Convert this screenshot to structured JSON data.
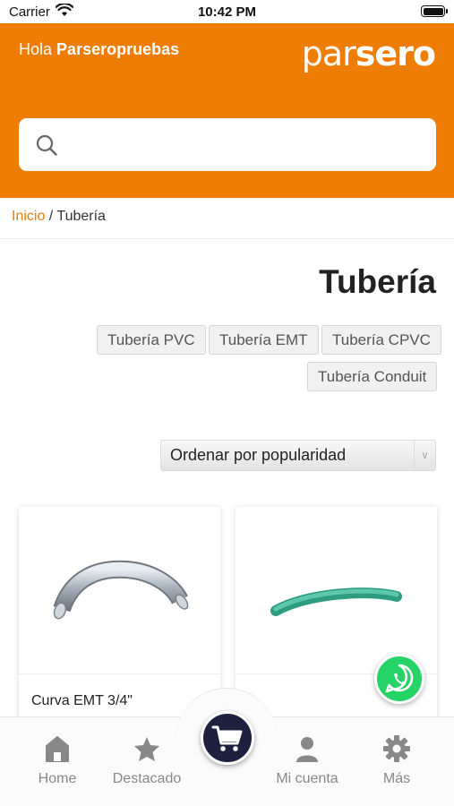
{
  "status_bar": {
    "carrier": "Carrier",
    "time": "10:42 PM"
  },
  "header": {
    "greeting_prefix": "Hola",
    "username": "Parseropruebas",
    "logo_light": "par",
    "logo_bold": "sero",
    "brand_color": "#ee7d05"
  },
  "search": {
    "value": "",
    "placeholder": ""
  },
  "breadcrumb": {
    "home": "Inicio",
    "separator": " / ",
    "current": "Tubería"
  },
  "page_title": "Tubería",
  "categories": [
    "Tubería PVC",
    "Tubería EMT",
    "Tubería CPVC",
    "Tubería Conduit"
  ],
  "sort": {
    "selected": "Ordenar por popularidad"
  },
  "products": [
    {
      "name": "Curva EMT 3/4\"",
      "image": "metal-elbow-pipe"
    },
    {
      "name": "",
      "image": "green-cpvc-pipe"
    }
  ],
  "tabbar": {
    "items": [
      {
        "label": "Home",
        "icon": "home-icon"
      },
      {
        "label": "Destacado",
        "icon": "star-icon"
      },
      {
        "label": "",
        "icon": "cart-icon"
      },
      {
        "label": "Mi cuenta",
        "icon": "user-icon"
      },
      {
        "label": "Más",
        "icon": "gear-icon"
      }
    ]
  },
  "colors": {
    "accent": "#ee7d05",
    "cart_button": "#1e2040",
    "whatsapp": "#25d366"
  }
}
